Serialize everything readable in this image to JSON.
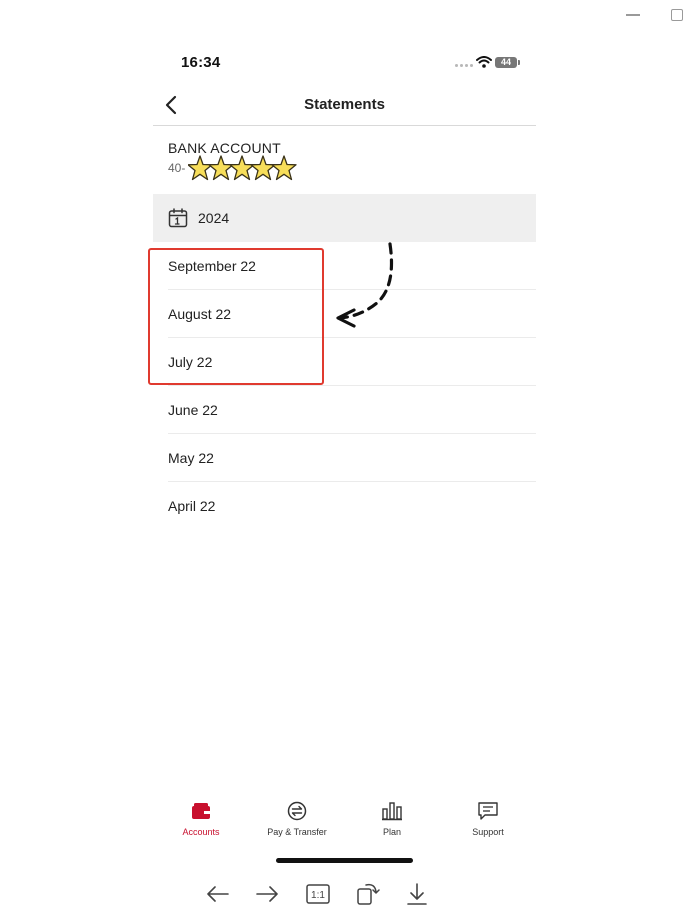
{
  "status_bar": {
    "time": "16:34",
    "battery": "44"
  },
  "header": {
    "title": "Statements"
  },
  "account": {
    "name": "BANK ACCOUNT",
    "number_prefix": "40-"
  },
  "year": "2024",
  "statements": [
    {
      "label": "September 22"
    },
    {
      "label": "August 22"
    },
    {
      "label": "July 22"
    },
    {
      "label": "June 22"
    },
    {
      "label": "May 22"
    },
    {
      "label": "April 22"
    }
  ],
  "tabs": [
    {
      "label": "Accounts",
      "icon": "wallet-icon",
      "active": true
    },
    {
      "label": "Pay & Transfer",
      "icon": "transfer-icon",
      "active": false
    },
    {
      "label": "Plan",
      "icon": "bar-chart-icon",
      "active": false
    },
    {
      "label": "Support",
      "icon": "chat-icon",
      "active": false
    }
  ],
  "viewer_toolbar": {
    "actual_size_label": "1:1"
  },
  "colors": {
    "accent": "#c8102e",
    "highlight": "#e03a2f",
    "year_bar": "#efefef"
  }
}
